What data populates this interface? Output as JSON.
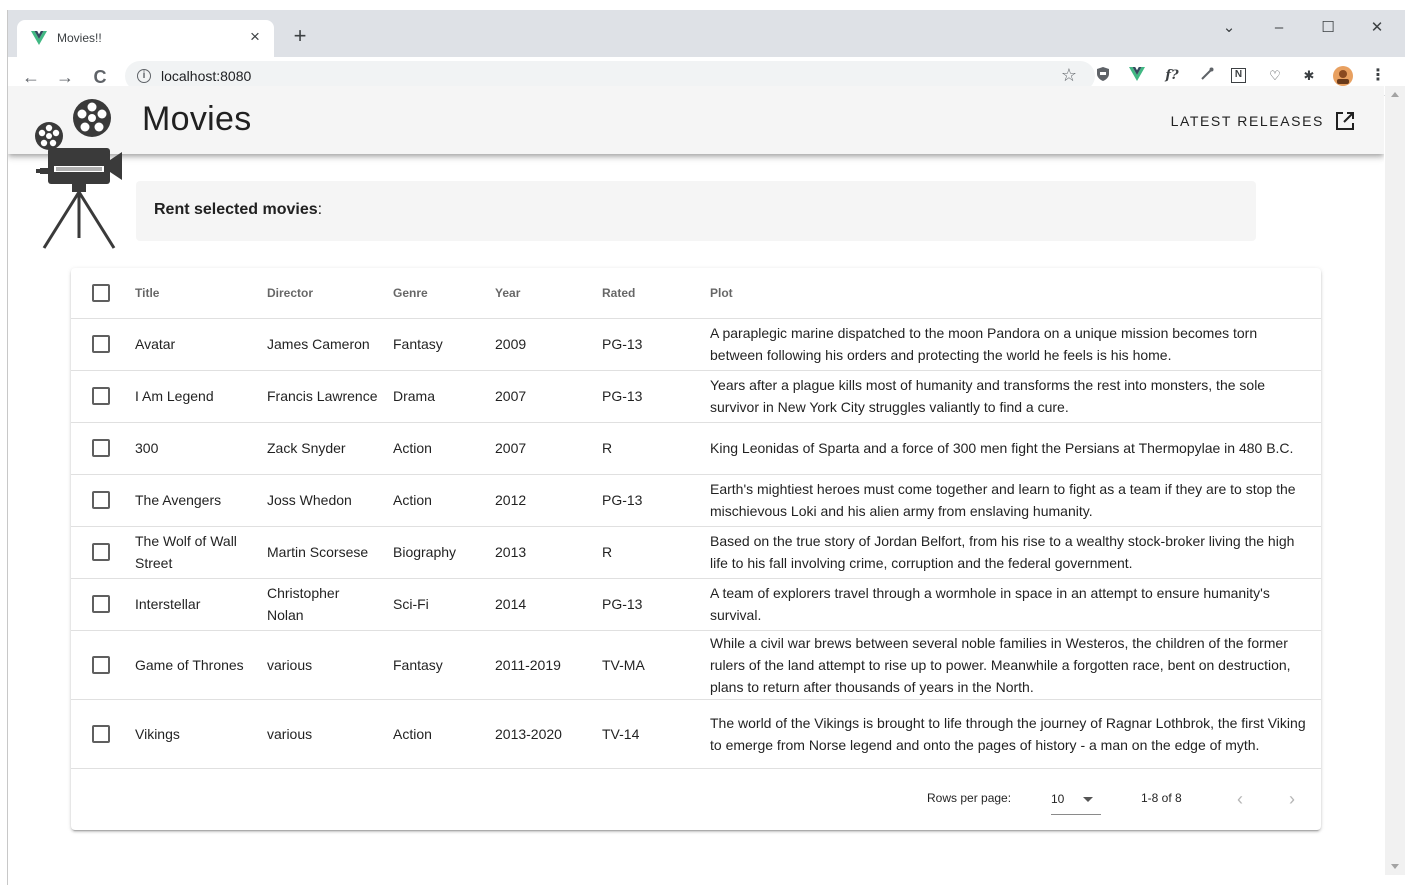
{
  "browser": {
    "tab_title": "Movies!!",
    "tab_close": "×",
    "new_tab": "+",
    "url": "localhost:8080",
    "back": "←",
    "forward": "→",
    "reload": "C",
    "star": "☆",
    "minimize": "–",
    "maximize": "☐",
    "close": "✕",
    "dropdown": "⌄",
    "extensions": [
      "shield-icon",
      "vue-devtools-icon",
      "formula-icon",
      "eyedropper-icon",
      "notion-icon",
      "pocket-icon",
      "puzzle-icon",
      "profile-avatar"
    ],
    "ext_glyphs": {
      "formula": "f?",
      "notion": "N",
      "pocket": "♡",
      "puzzle": "✱"
    }
  },
  "app": {
    "title": "Movies",
    "latest_releases": "LATEST RELEASES",
    "rent_label": "Rent selected movies",
    "rent_suffix": ":"
  },
  "table": {
    "headers": [
      "Title",
      "Director",
      "Genre",
      "Year",
      "Rated",
      "Plot"
    ],
    "rows": [
      {
        "title": "Avatar",
        "director": "James Cameron",
        "genre": "Fantasy",
        "year": "2009",
        "rated": "PG-13",
        "plot": "A paraplegic marine dispatched to the moon Pandora on a unique mission becomes torn between following his orders and protecting the world he feels is his home."
      },
      {
        "title": "I Am Legend",
        "director": "Francis Lawrence",
        "genre": "Drama",
        "year": "2007",
        "rated": "PG-13",
        "plot": "Years after a plague kills most of humanity and transforms the rest into monsters, the sole survivor in New York City struggles valiantly to find a cure."
      },
      {
        "title": "300",
        "director": "Zack Snyder",
        "genre": "Action",
        "year": "2007",
        "rated": "R",
        "plot": "King Leonidas of Sparta and a force of 300 men fight the Persians at Thermopylae in 480 B.C."
      },
      {
        "title": "The Avengers",
        "director": "Joss Whedon",
        "genre": "Action",
        "year": "2012",
        "rated": "PG-13",
        "plot": "Earth's mightiest heroes must come together and learn to fight as a team if they are to stop the mischievous Loki and his alien army from enslaving humanity."
      },
      {
        "title": "The Wolf of Wall Street",
        "director": "Martin Scorsese",
        "genre": "Biography",
        "year": "2013",
        "rated": "R",
        "plot": "Based on the true story of Jordan Belfort, from his rise to a wealthy stock-broker living the high life to his fall involving crime, corruption and the federal government."
      },
      {
        "title": "Interstellar",
        "director": "Christopher Nolan",
        "genre": "Sci-Fi",
        "year": "2014",
        "rated": "PG-13",
        "plot": "A team of explorers travel through a wormhole in space in an attempt to ensure humanity's survival."
      },
      {
        "title": "Game of Thrones",
        "director": "various",
        "genre": "Fantasy",
        "year": "2011-2019",
        "rated": "TV-MA",
        "plot": "While a civil war brews between several noble families in Westeros, the children of the former rulers of the land attempt to rise up to power. Meanwhile a forgotten race, bent on destruction, plans to return after thousands of years in the North."
      },
      {
        "title": "Vikings",
        "director": "various",
        "genre": "Action",
        "year": "2013-2020",
        "rated": "TV-14",
        "plot": "The world of the Vikings is brought to life through the journey of Ragnar Lothbrok, the first Viking to emerge from Norse legend and onto the pages of history - a man on the edge of myth."
      }
    ]
  },
  "pagination": {
    "rows_per_page_label": "Rows per page:",
    "rows_per_page_value": "10",
    "range": "1-8 of 8",
    "prev": "‹",
    "next": "›"
  },
  "colors": {
    "appbar": "#f5f5f5",
    "vue_green": "#41b883",
    "vue_dark": "#35495e"
  }
}
